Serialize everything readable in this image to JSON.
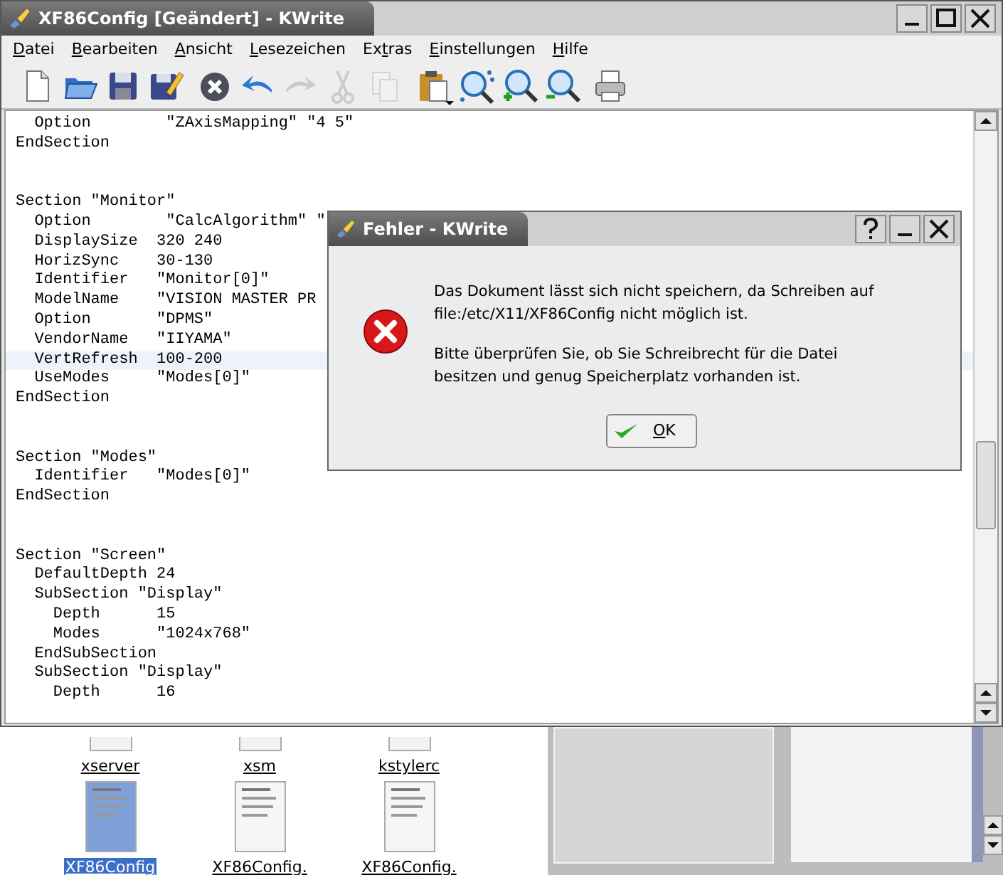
{
  "window": {
    "title": "XF86Config [Geändert] - KWrite"
  },
  "menu": [
    {
      "key": "D",
      "after": "atei"
    },
    {
      "key": "B",
      "after": "earbeiten"
    },
    {
      "key": "A",
      "after": "nsicht"
    },
    {
      "key": "L",
      "after": "esezeichen"
    },
    {
      "before": "Ex",
      "key": "t",
      "after": "ras"
    },
    {
      "key": "E",
      "after": "instellungen"
    },
    {
      "key": "H",
      "after": "ilfe"
    }
  ],
  "toolbar": [
    {
      "kind": "new",
      "disabled": false
    },
    {
      "kind": "open",
      "disabled": false
    },
    {
      "kind": "save",
      "disabled": false
    },
    {
      "kind": "saveas",
      "disabled": false
    },
    {
      "kind": "close",
      "disabled": false
    },
    {
      "kind": "undo",
      "disabled": false
    },
    {
      "kind": "redo",
      "disabled": true
    },
    {
      "kind": "cut",
      "disabled": true
    },
    {
      "kind": "copy",
      "disabled": true
    },
    {
      "kind": "paste",
      "disabled": false
    },
    {
      "kind": "find",
      "disabled": false
    },
    {
      "kind": "zoomin",
      "disabled": false
    },
    {
      "kind": "zoomout",
      "disabled": false
    },
    {
      "kind": "print",
      "disabled": false
    }
  ],
  "editor": {
    "blocks": [
      {
        "lines": [
          {
            "text": "  Option        \"ZAxisMapping\" \"4 5\"",
            "current": false
          },
          {
            "text": "EndSection",
            "current": false
          }
        ]
      },
      {
        "lines": [
          {
            "text": "Section \"Monitor\"",
            "current": false
          },
          {
            "text": "  Option        \"CalcAlgorithm\" \"",
            "current": false
          },
          {
            "text": "  DisplaySize  320 240",
            "current": false
          },
          {
            "text": "  HorizSync    30-130",
            "current": false
          },
          {
            "text": "  Identifier   \"Monitor[0]\"",
            "current": false
          },
          {
            "text": "  ModelName    \"VISION MASTER PR",
            "current": false
          },
          {
            "text": "  Option       \"DPMS\"",
            "current": false
          },
          {
            "text": "  VendorName   \"IIYAMA\"",
            "current": false
          },
          {
            "text": "  VertRefresh  100-200",
            "current": true
          },
          {
            "text": "  UseModes     \"Modes[0]\"",
            "current": false
          },
          {
            "text": "EndSection",
            "current": false
          }
        ]
      },
      {
        "lines": [
          {
            "text": "Section \"Modes\"",
            "current": false
          },
          {
            "text": "  Identifier   \"Modes[0]\"",
            "current": false
          },
          {
            "text": "EndSection",
            "current": false
          }
        ]
      },
      {
        "lines": [
          {
            "text": "Section \"Screen\"",
            "current": false
          },
          {
            "text": "  DefaultDepth 24",
            "current": false
          },
          {
            "text": "  SubSection \"Display\"",
            "current": false
          },
          {
            "text": "    Depth      15",
            "current": false
          },
          {
            "text": "    Modes      \"1024x768\"",
            "current": false
          },
          {
            "text": "  EndSubSection",
            "current": false
          },
          {
            "text": "  SubSection \"Display\"",
            "current": false
          },
          {
            "text": "    Depth      16",
            "current": false
          }
        ]
      }
    ]
  },
  "files": [
    {
      "name": "xserver",
      "selected": false,
      "kind": "cut"
    },
    {
      "name": "xsm",
      "selected": false,
      "kind": "cut"
    },
    {
      "name": "kstylerc",
      "selected": false,
      "kind": "cut"
    },
    {
      "name": "XF86Config",
      "selected": true,
      "kind": "doc"
    },
    {
      "name": "XF86Config.",
      "selected": false,
      "kind": "doc"
    },
    {
      "name": "XF86Config.",
      "selected": false,
      "kind": "doc"
    }
  ],
  "dialog": {
    "title": "Fehler - KWrite",
    "paragraphs": [
      [
        "Das Dokument lässt sich nicht speichern, da Schreiben auf",
        "file:/etc/X11/XF86Config nicht möglich ist."
      ],
      [
        "Bitte überprüfen Sie, ob Sie Schreibrecht für die Datei",
        "besitzen und genug Speicherplatz vorhanden ist."
      ]
    ],
    "button": {
      "key": "O",
      "after": "K"
    }
  }
}
